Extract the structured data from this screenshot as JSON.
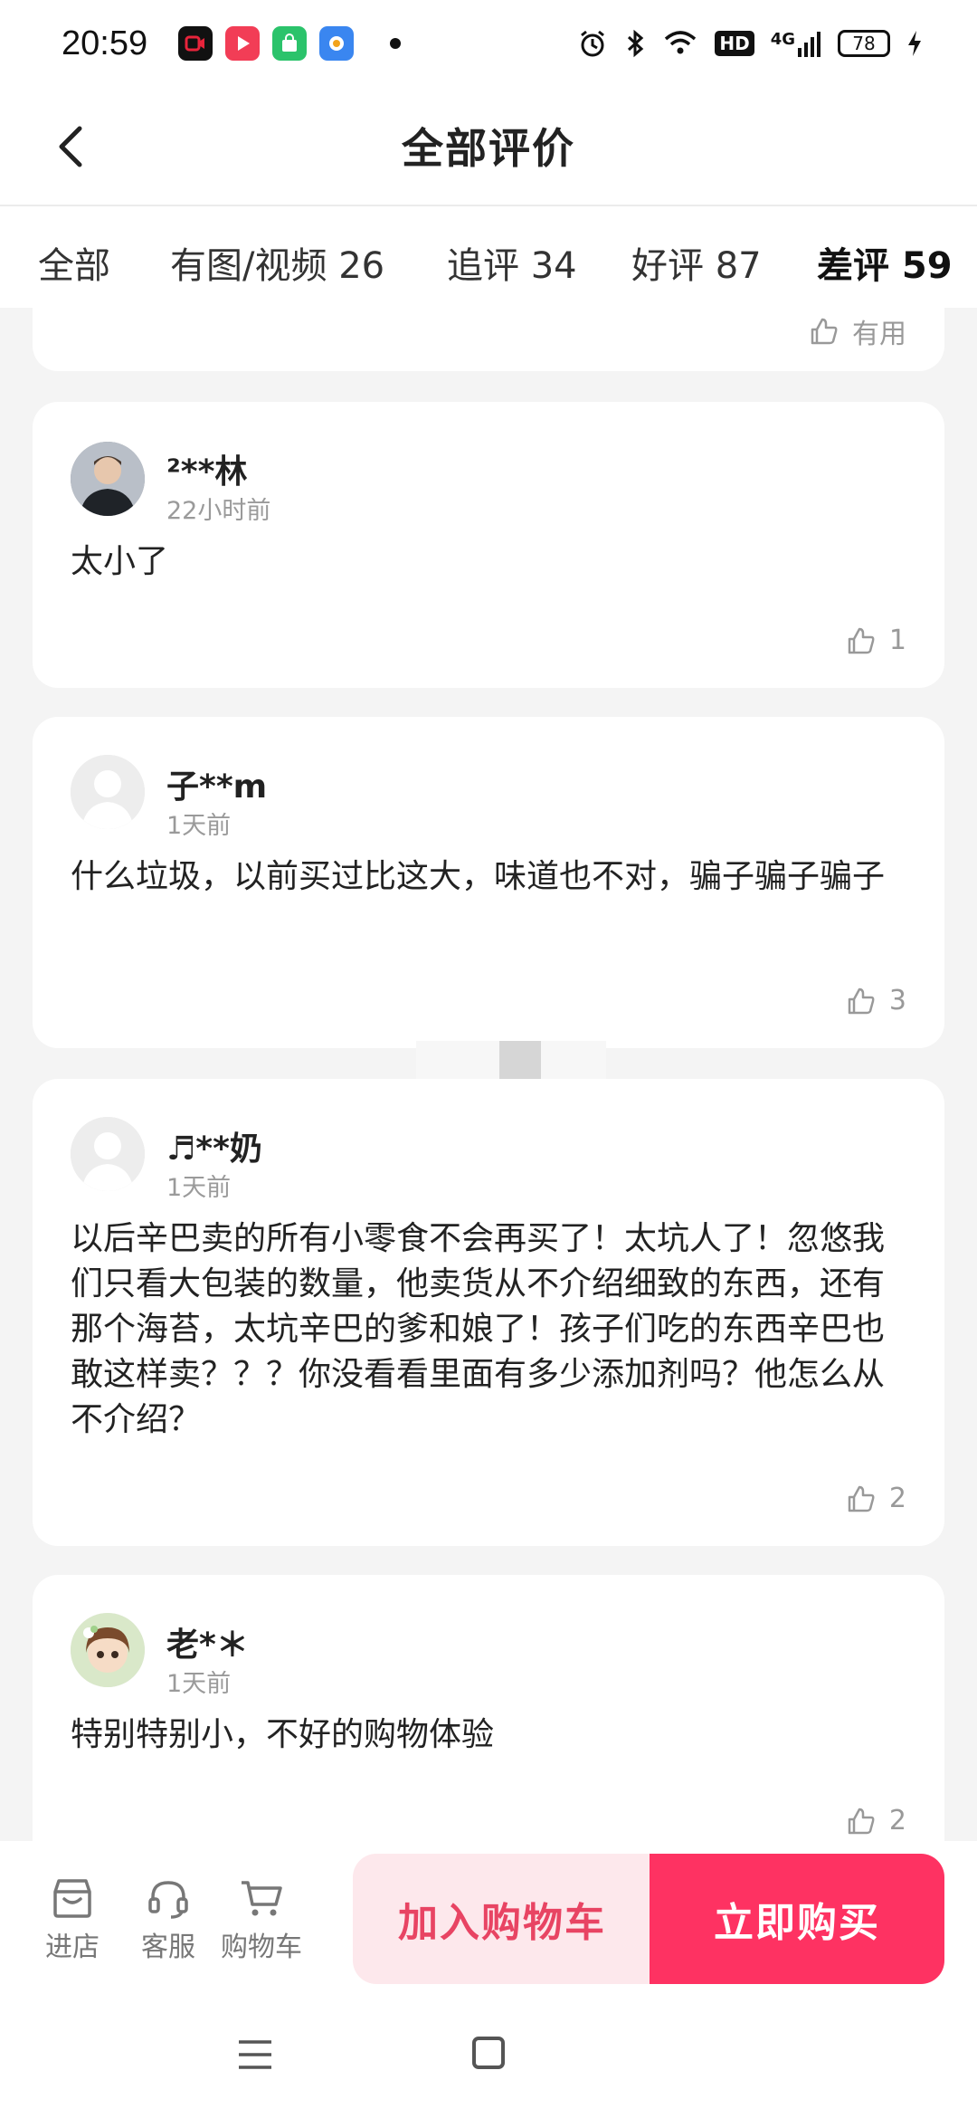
{
  "status_bar": {
    "time": "20:59",
    "apps": [
      {
        "name": "video-app-icon",
        "color": "#e8243b"
      },
      {
        "name": "play-app-icon",
        "color": "#f23d56"
      },
      {
        "name": "shopping-app-icon",
        "color": "#2bc36b"
      },
      {
        "name": "browser-app-icon",
        "color": "#3a86f0"
      }
    ],
    "hd": "HD",
    "network": "4G",
    "battery": "78"
  },
  "header": {
    "title": "全部评价"
  },
  "tabs": [
    {
      "label": "全部"
    },
    {
      "label": "有图/视频 26"
    },
    {
      "label": "追评 34"
    },
    {
      "label": "好评 87"
    },
    {
      "label": "差评 59",
      "active": true
    }
  ],
  "reviews": [
    {
      "username": "",
      "time": "",
      "text": "",
      "useful": "有用"
    },
    {
      "username": "²**林",
      "time": "22小时前",
      "text": "太小了",
      "useful": "1"
    },
    {
      "username": "子**m",
      "time": "1天前",
      "text": "什么垃圾，以前买过比这大，味道也不对，骗子骗子骗子",
      "useful": "3"
    },
    {
      "username": "♬**奶",
      "time": "1天前",
      "text": "以后辛巴卖的所有小零食不会再买了！太坑人了！忽悠我们只看大包装的数量，他卖货从不介绍细致的东西，还有那个海苔，太坑辛巴的爹和娘了！孩子们吃的东西辛巴也敢这样卖？？？你没看看里面有多少添加剂吗？他怎么从不介绍？",
      "useful": "2"
    },
    {
      "username": "老*＊",
      "time": "1天前",
      "text": "特别特别小，不好的购物体验",
      "useful": "2"
    }
  ],
  "bottom_bar": {
    "store": "进店",
    "service": "客服",
    "cart": "购物车",
    "add_to_cart": "加入购物车",
    "buy_now": "立即购买"
  },
  "colors": {
    "accent": "#fe3262",
    "accent_light": "#fde8ec",
    "accent_text": "#e84463"
  }
}
